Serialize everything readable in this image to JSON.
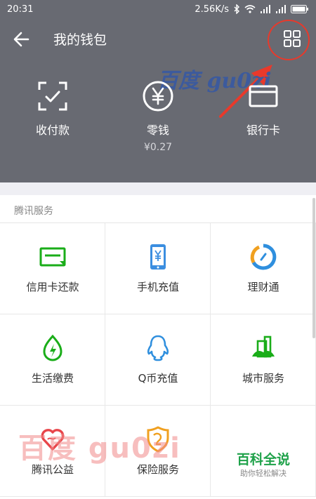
{
  "status_bar": {
    "time": "20:31",
    "speed": "2.56K/s"
  },
  "header": {
    "title": "我的钱包",
    "watermark": "百度 gu0zi"
  },
  "wallet": {
    "items": [
      {
        "label": "收付款",
        "sub": ""
      },
      {
        "label": "零钱",
        "sub": "¥0.27"
      },
      {
        "label": "银行卡",
        "sub": ""
      }
    ]
  },
  "services": {
    "section_title": "腾讯服务",
    "items": [
      {
        "label": "信用卡还款",
        "icon": "credit-card-repay-icon"
      },
      {
        "label": "手机充值",
        "icon": "phone-recharge-icon"
      },
      {
        "label": "理财通",
        "icon": "wealth-icon"
      },
      {
        "label": "生活缴费",
        "icon": "bill-payment-icon"
      },
      {
        "label": "Q币充值",
        "icon": "qq-icon"
      },
      {
        "label": "城市服务",
        "icon": "city-service-icon"
      },
      {
        "label": "腾讯公益",
        "icon": "charity-heart-icon"
      },
      {
        "label": "保险服务",
        "icon": "insurance-icon"
      }
    ],
    "baike": {
      "title": "百科全说",
      "subtitle": "助你轻松解决"
    }
  },
  "bottom_watermark": "百度 gu0zi",
  "colors": {
    "header_bg": "#686a72",
    "accent_green": "#1aad19",
    "annotation_red": "#e8392b"
  }
}
